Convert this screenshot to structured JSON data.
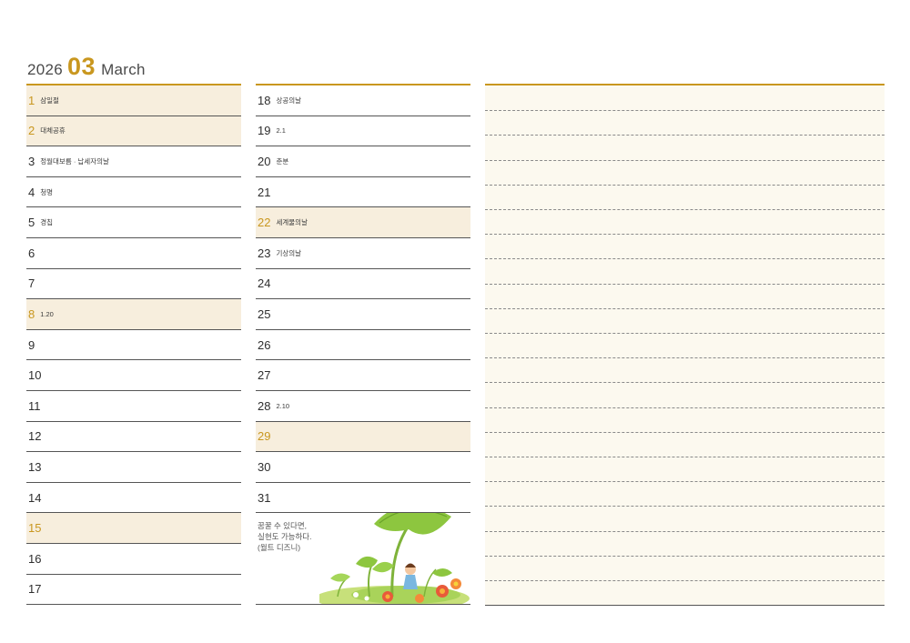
{
  "header": {
    "year": "2026",
    "month_num": "03",
    "month_name": "March"
  },
  "left_days": [
    {
      "day": "1",
      "note": "삼일절",
      "highlight": true
    },
    {
      "day": "2",
      "note": "대체공휴",
      "highlight": true
    },
    {
      "day": "3",
      "note": "정월대보름 · 납세자의날",
      "highlight": false
    },
    {
      "day": "4",
      "note": "청명",
      "highlight": false
    },
    {
      "day": "5",
      "note": "경칩",
      "highlight": false
    },
    {
      "day": "6",
      "note": "",
      "highlight": false
    },
    {
      "day": "7",
      "note": "",
      "highlight": false
    },
    {
      "day": "8",
      "note": "1.20",
      "highlight": true
    },
    {
      "day": "9",
      "note": "",
      "highlight": false
    },
    {
      "day": "10",
      "note": "",
      "highlight": false
    },
    {
      "day": "11",
      "note": "",
      "highlight": false
    },
    {
      "day": "12",
      "note": "",
      "highlight": false
    },
    {
      "day": "13",
      "note": "",
      "highlight": false
    },
    {
      "day": "14",
      "note": "",
      "highlight": false
    },
    {
      "day": "15",
      "note": "",
      "highlight": true
    },
    {
      "day": "16",
      "note": "",
      "highlight": false
    },
    {
      "day": "17",
      "note": "",
      "highlight": false
    }
  ],
  "mid_days": [
    {
      "day": "18",
      "note": "상공의날",
      "highlight": false
    },
    {
      "day": "19",
      "note": "2.1",
      "highlight": false
    },
    {
      "day": "20",
      "note": "춘분",
      "highlight": false
    },
    {
      "day": "21",
      "note": "",
      "highlight": false
    },
    {
      "day": "22",
      "note": "세계물의날",
      "highlight": true
    },
    {
      "day": "23",
      "note": "기상의날",
      "highlight": false
    },
    {
      "day": "24",
      "note": "",
      "highlight": false
    },
    {
      "day": "25",
      "note": "",
      "highlight": false
    },
    {
      "day": "26",
      "note": "",
      "highlight": false
    },
    {
      "day": "27",
      "note": "",
      "highlight": false
    },
    {
      "day": "28",
      "note": "2.10",
      "highlight": false
    },
    {
      "day": "29",
      "note": "",
      "highlight": true
    },
    {
      "day": "30",
      "note": "",
      "highlight": false
    },
    {
      "day": "31",
      "note": "",
      "highlight": false
    }
  ],
  "quote": {
    "line1": "꿈꿀 수 있다면,",
    "line2": "실현도 가능하다.",
    "line3": "(월트 디즈니)"
  },
  "colors": {
    "accent": "#c9971f",
    "highlight_bg": "#f7eedd",
    "notes_bg": "#fcf9ef"
  }
}
